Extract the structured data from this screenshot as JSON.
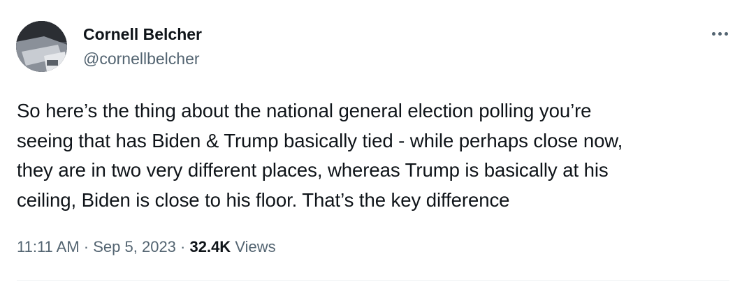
{
  "author": {
    "display_name": "Cornell Belcher",
    "handle": "@cornellbelcher"
  },
  "tweet": {
    "lines": [
      "So here’s the thing about the national general election polling you’re",
      "seeing that has Biden & Trump basically tied - while perhaps close now,",
      "they are in two very different places, whereas Trump is basically at his",
      "ceiling, Biden is close to his floor. That’s the key difference"
    ]
  },
  "meta": {
    "time": "11:11 AM",
    "separator": " · ",
    "date": "Sep 5, 2023",
    "views_count": "32.4K",
    "views_label": "Views"
  },
  "icons": {
    "more": "more-horizontal-icon"
  },
  "colors": {
    "text_primary": "#0f1419",
    "text_secondary": "#536471",
    "divider": "#eff3f4"
  }
}
